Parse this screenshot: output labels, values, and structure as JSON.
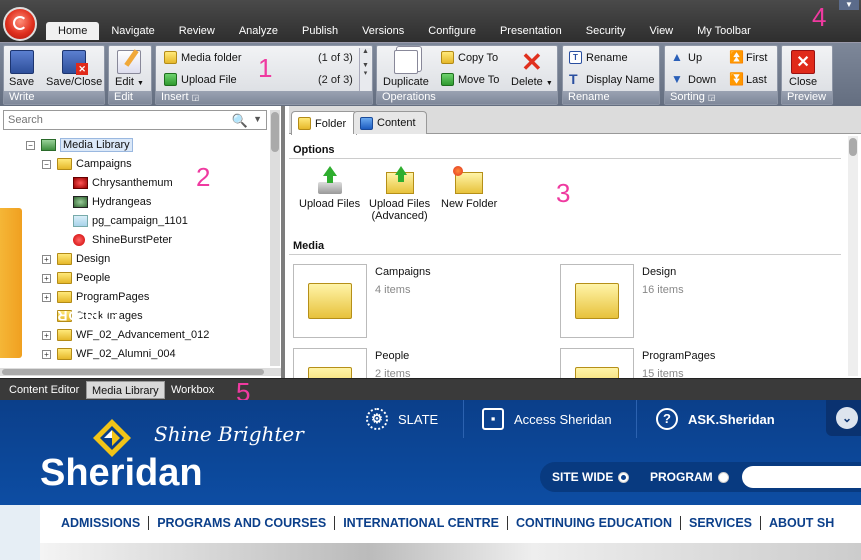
{
  "ribbon_tabs": [
    "Home",
    "Navigate",
    "Review",
    "Analyze",
    "Publish",
    "Versions",
    "Configure",
    "Presentation",
    "Security",
    "View",
    "My Toolbar"
  ],
  "markers": [
    "1",
    "2",
    "3",
    "4",
    "5"
  ],
  "ribbon": {
    "write": {
      "title": "Write",
      "save": "Save",
      "save_close": "Save/Close"
    },
    "edit": {
      "title": "Edit",
      "edit": "Edit"
    },
    "insert": {
      "title": "Insert",
      "media_folder": "Media folder",
      "media_folder_count": "(1 of 3)",
      "upload_file": "Upload File",
      "upload_file_count": "(2 of 3)"
    },
    "operations": {
      "title": "Operations",
      "duplicate": "Duplicate",
      "copy_to": "Copy To",
      "move_to": "Move To",
      "delete": "Delete"
    },
    "rename": {
      "title": "Rename",
      "rename": "Rename",
      "display_name": "Display Name"
    },
    "sorting": {
      "title": "Sorting",
      "up": "Up",
      "first": "First",
      "down": "Down",
      "last": "Last"
    },
    "preview": {
      "title": "Preview",
      "close": "Close"
    }
  },
  "search": {
    "placeholder": "Search"
  },
  "explore_label": "EXPLORE",
  "tree": [
    {
      "label": "Media Library",
      "level": 0,
      "expander": "minus",
      "icon": "media-library",
      "selected": true
    },
    {
      "label": "Campaigns",
      "level": 1,
      "expander": "minus",
      "icon": "folder"
    },
    {
      "label": "Chrysanthemum",
      "level": 2,
      "expander": "",
      "icon": "image-red"
    },
    {
      "label": "Hydrangeas",
      "level": 2,
      "expander": "",
      "icon": "image-green"
    },
    {
      "label": "pg_campaign_1101",
      "level": 2,
      "expander": "",
      "icon": "image-light"
    },
    {
      "label": "ShineBurstPeter",
      "level": 2,
      "expander": "",
      "icon": "flash"
    },
    {
      "label": "Design",
      "level": 1,
      "expander": "plus",
      "icon": "folder"
    },
    {
      "label": "People",
      "level": 1,
      "expander": "plus",
      "icon": "folder"
    },
    {
      "label": "ProgramPages",
      "level": 1,
      "expander": "plus",
      "icon": "folder"
    },
    {
      "label": "Stock Images",
      "level": 1,
      "expander": "",
      "icon": "folder"
    },
    {
      "label": "WF_02_Advancement_012",
      "level": 1,
      "expander": "plus",
      "icon": "folder"
    },
    {
      "label": "WF_02_Alumni_004",
      "level": 1,
      "expander": "plus",
      "icon": "folder"
    }
  ],
  "content_tabs": {
    "folder": "Folder",
    "content": "Content"
  },
  "options": {
    "title": "Options",
    "upload_files": "Upload Files",
    "upload_files_adv_1": "Upload Files",
    "upload_files_adv_2": "(Advanced)",
    "new_folder": "New Folder"
  },
  "media": {
    "title": "Media",
    "items": [
      {
        "name": "Campaigns",
        "count": "4 items"
      },
      {
        "name": "Design",
        "count": "16 items"
      },
      {
        "name": "People",
        "count": "2 items"
      },
      {
        "name": "ProgramPages",
        "count": "15 items"
      }
    ]
  },
  "bottom_tabs": [
    "Content Editor",
    "Media Library",
    "Workbox"
  ],
  "site": {
    "tagline": "Shine Brighter",
    "brand": "Sheridan",
    "top_links": [
      "SLATE",
      "Access Sheridan",
      "ASK.Sheridan"
    ],
    "ask_prefix": "ASK.",
    "scope": {
      "site_wide": "SITE WIDE",
      "program": "PROGRAM"
    },
    "nav": [
      "ADMISSIONS",
      "PROGRAMS AND COURSES",
      "INTERNATIONAL CENTRE",
      "CONTINUING EDUCATION",
      "SERVICES",
      "ABOUT SH"
    ]
  },
  "colors": {
    "marker": "#ef3aa0",
    "brand_blue": "#0b3f8a",
    "explore_orange": "#f5b637"
  }
}
